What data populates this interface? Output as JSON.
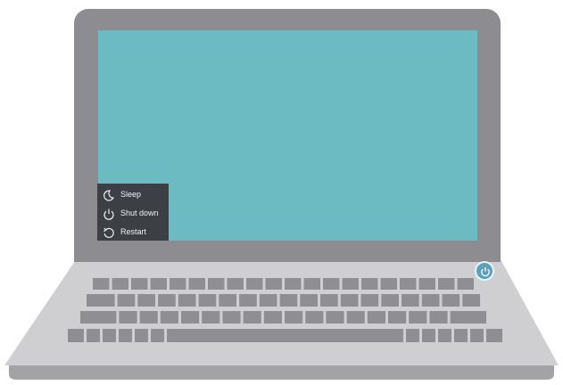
{
  "power_menu": {
    "items": [
      {
        "label": "Sleep",
        "icon": "moon-icon"
      },
      {
        "label": "Shut down",
        "icon": "power-icon"
      },
      {
        "label": "Restart",
        "icon": "restart-icon"
      }
    ]
  },
  "colors": {
    "screen": "#6cbbc3",
    "bezel": "#8d8d91",
    "menu_bg": "#3c3f43",
    "deck": "#cfcfd2",
    "keys": "#8f8f93",
    "power_button": "#5f9fb8"
  }
}
